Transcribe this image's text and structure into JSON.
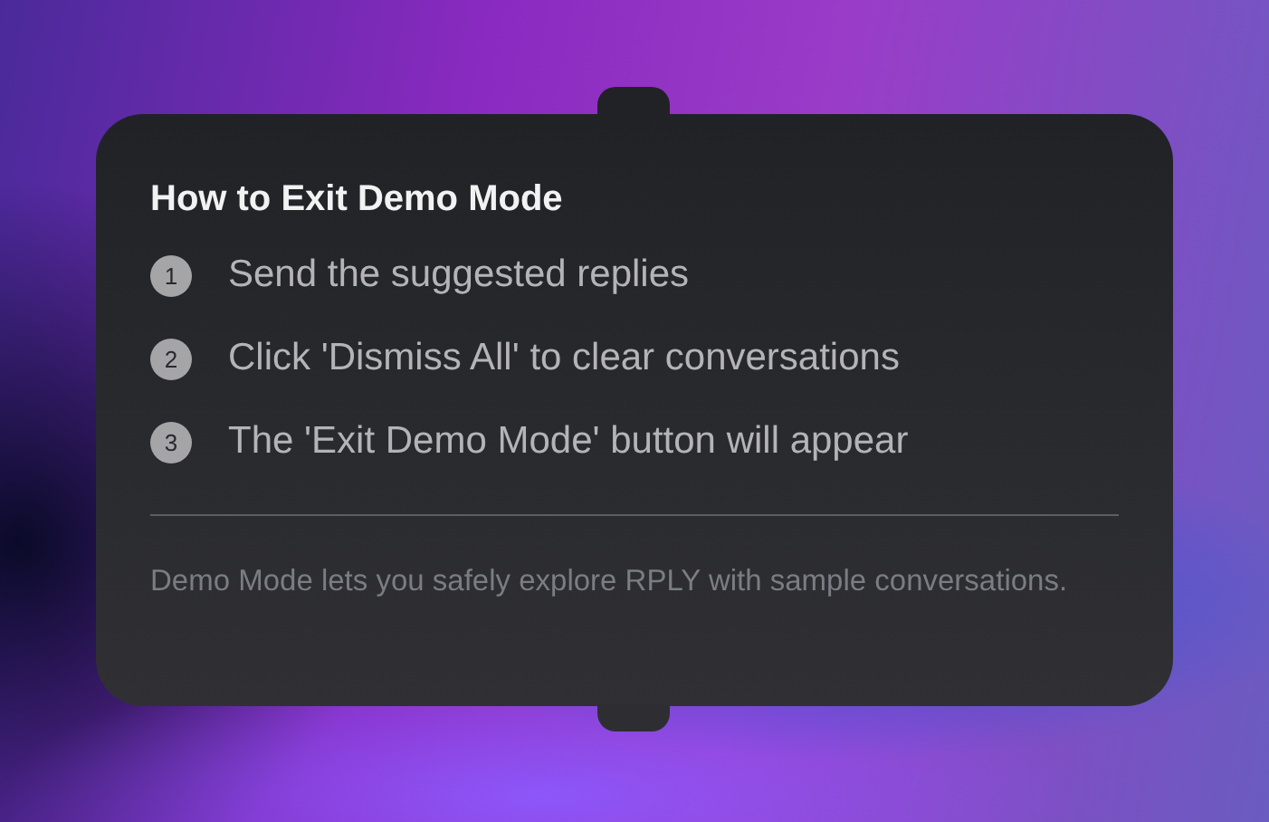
{
  "popover": {
    "title": "How to Exit Demo Mode",
    "steps": [
      {
        "number": "1",
        "text": "Send the suggested replies"
      },
      {
        "number": "2",
        "text": "Click 'Dismiss All' to clear conversations"
      },
      {
        "number": "3",
        "text": "The 'Exit Demo Mode' button will appear"
      }
    ],
    "footer": "Demo Mode lets you safely explore RPLY with sample conversations."
  }
}
